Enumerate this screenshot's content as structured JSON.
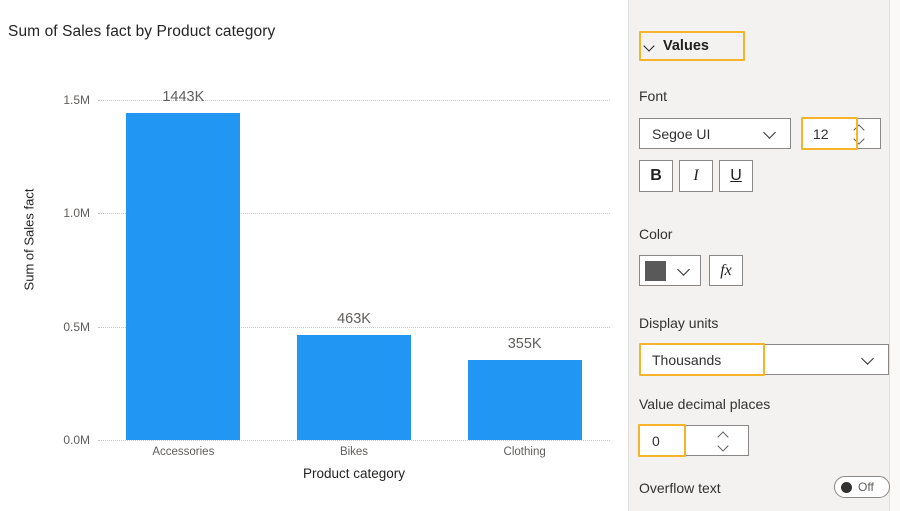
{
  "chart_data": {
    "type": "bar",
    "title": "Sum of Sales fact by Product category",
    "categories": [
      "Accessories",
      "Bikes",
      "Clothing"
    ],
    "values": [
      1443000,
      463000,
      355000
    ],
    "data_labels": [
      "1443K",
      "463K",
      "355K"
    ],
    "xlabel": "Product category",
    "ylabel": "Sum of Sales fact",
    "ytick_labels": [
      "0.0M",
      "0.5M",
      "1.0M",
      "1.5M"
    ],
    "ytick_values": [
      0,
      500000,
      1000000,
      1500000
    ],
    "ylim": [
      0,
      1500000
    ],
    "grid": true,
    "legend": "none",
    "bar_color": "#2196f3"
  },
  "panel": {
    "section": {
      "title": "Values",
      "expand_icon": "chevron-down-icon",
      "highlighted": true
    },
    "font": {
      "label": "Font",
      "family_value": "Segoe UI",
      "family_icon": "chevron-down-icon",
      "size_value": "12",
      "size_highlighted": true,
      "stepper_icon": "spinner-arrows-icon",
      "bold_label": "B",
      "italic_label": "I",
      "underline_label": "U"
    },
    "color": {
      "label": "Color",
      "swatch_hex": "#595959",
      "dropdown_icon": "chevron-down-icon",
      "fx_label": "fx"
    },
    "display_units": {
      "label": "Display units",
      "value": "Thousands",
      "dropdown_icon": "chevron-down-icon",
      "highlighted": true
    },
    "decimals": {
      "label": "Value decimal places",
      "value": "0",
      "stepper_icon": "spinner-arrows-icon",
      "highlighted": true
    },
    "overflow": {
      "label": "Overflow text",
      "state": "Off"
    }
  },
  "theme": {
    "accent_highlight": "#f5b429",
    "panel_bg": "#f3f2f1",
    "text": "#252423",
    "muted_text": "#605e5c"
  }
}
